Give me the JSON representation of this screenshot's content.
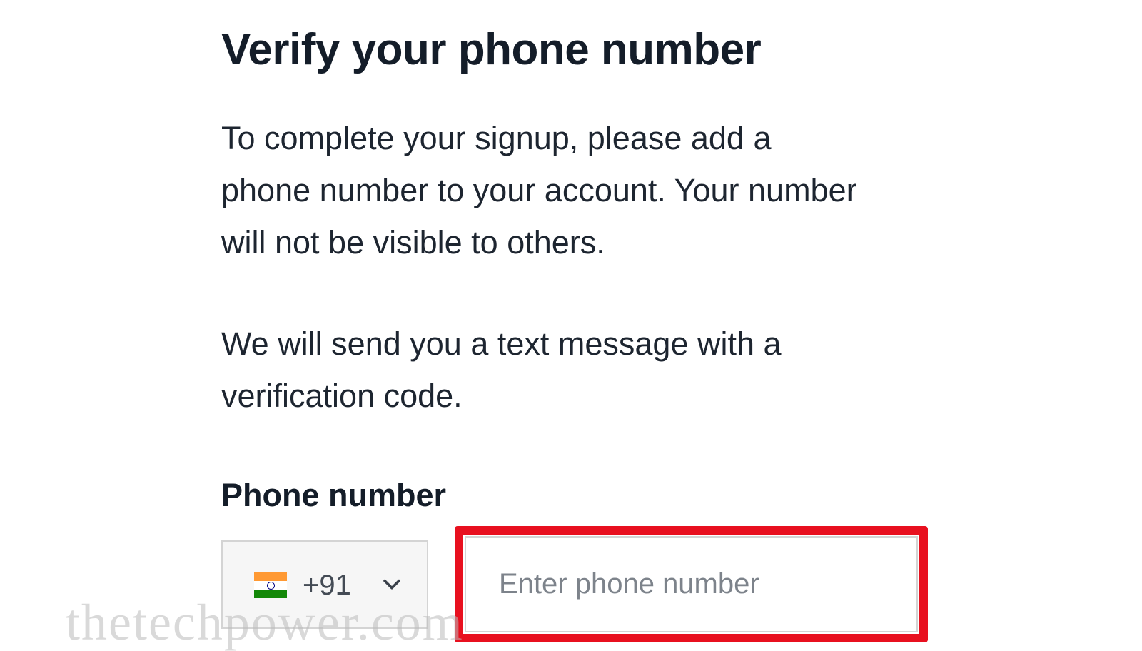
{
  "page": {
    "title": "Verify your phone number",
    "intro_lines": [
      "To complete your signup, please add a",
      "phone number to your account. Your number",
      "will not be visible to others."
    ],
    "sms_lines": [
      "We will send you a text message with a",
      "verification code."
    ]
  },
  "phone_field": {
    "label": "Phone number",
    "country": {
      "flag_icon": "india-flag-icon",
      "dial_code": "+91"
    },
    "placeholder": "Enter phone number",
    "value": ""
  },
  "colors": {
    "highlight": "#e8101f",
    "text": "#1d2530",
    "placeholder": "#7d838b"
  },
  "watermark": "thetechpower.com"
}
